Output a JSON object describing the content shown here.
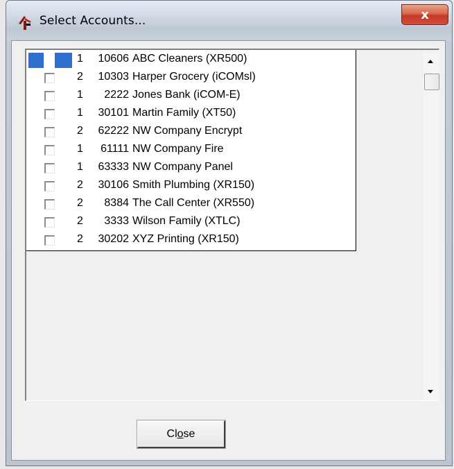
{
  "window": {
    "title": "Select Accounts...",
    "close_glyph": "x",
    "icon": "app-logo-icon"
  },
  "accounts": [
    {
      "type": "1",
      "number": "10606",
      "name": "ABC Cleaners (XR500)",
      "checked": false,
      "selected": true
    },
    {
      "type": "2",
      "number": "10303",
      "name": "Harper Grocery (iCOMsl)",
      "checked": false
    },
    {
      "type": "1",
      "number": "2222",
      "name": "Jones Bank (iCOM-E)",
      "checked": false
    },
    {
      "type": "1",
      "number": "30101",
      "name": "Martin Family (XT50)",
      "checked": false
    },
    {
      "type": "2",
      "number": "62222",
      "name": "NW Company Encrypt",
      "checked": false
    },
    {
      "type": "1",
      "number": "61111",
      "name": "NW Company Fire",
      "checked": false
    },
    {
      "type": "1",
      "number": "63333",
      "name": "NW Company Panel",
      "checked": false
    },
    {
      "type": "2",
      "number": "30106",
      "name": "Smith Plumbing (XR150)",
      "checked": false
    },
    {
      "type": "2",
      "number": "8384",
      "name": "The Call Center (XR550)",
      "checked": false
    },
    {
      "type": "2",
      "number": "3333",
      "name": "Wilson Family (XTLC)",
      "checked": false
    },
    {
      "type": "2",
      "number": "30202",
      "name": "XYZ Printing (XR150)",
      "checked": false
    }
  ],
  "footer": {
    "close_label_pre": "Cl",
    "close_label_mnemonic": "o",
    "close_label_post": "se"
  },
  "colors": {
    "selection": "#2f6fd0",
    "close_button_red": "#c4382b"
  }
}
